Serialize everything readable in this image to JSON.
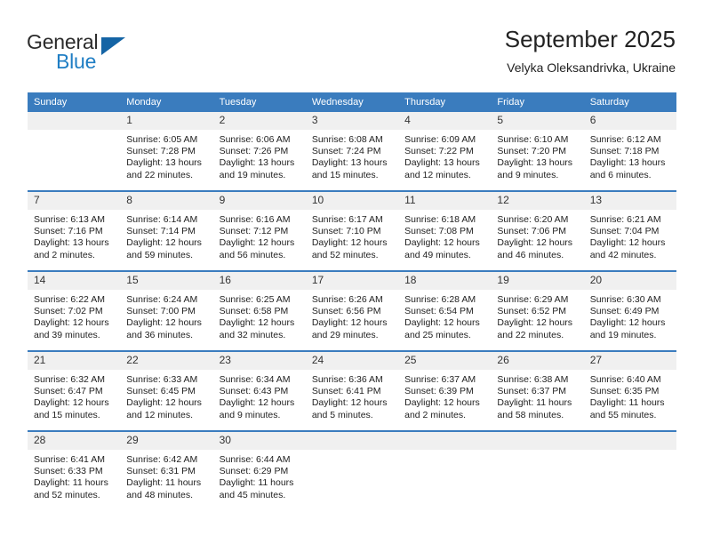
{
  "brand": {
    "name_part1": "General",
    "name_part2": "Blue",
    "accent_color": "#1464a5",
    "blue_text_color": "#1f7ec4"
  },
  "header": {
    "title": "September 2025",
    "subtitle": "Velyka Oleksandrivka, Ukraine",
    "header_bg_color": "#3a7cbe",
    "daynum_bg_color": "#f0f0f0"
  },
  "weekday_headers": [
    "Sunday",
    "Monday",
    "Tuesday",
    "Wednesday",
    "Thursday",
    "Friday",
    "Saturday"
  ],
  "weeks": [
    [
      {
        "day": "",
        "lines": []
      },
      {
        "day": "1",
        "lines": [
          "Sunrise: 6:05 AM",
          "Sunset: 7:28 PM",
          "Daylight: 13 hours",
          "and 22 minutes."
        ]
      },
      {
        "day": "2",
        "lines": [
          "Sunrise: 6:06 AM",
          "Sunset: 7:26 PM",
          "Daylight: 13 hours",
          "and 19 minutes."
        ]
      },
      {
        "day": "3",
        "lines": [
          "Sunrise: 6:08 AM",
          "Sunset: 7:24 PM",
          "Daylight: 13 hours",
          "and 15 minutes."
        ]
      },
      {
        "day": "4",
        "lines": [
          "Sunrise: 6:09 AM",
          "Sunset: 7:22 PM",
          "Daylight: 13 hours",
          "and 12 minutes."
        ]
      },
      {
        "day": "5",
        "lines": [
          "Sunrise: 6:10 AM",
          "Sunset: 7:20 PM",
          "Daylight: 13 hours",
          "and 9 minutes."
        ]
      },
      {
        "day": "6",
        "lines": [
          "Sunrise: 6:12 AM",
          "Sunset: 7:18 PM",
          "Daylight: 13 hours",
          "and 6 minutes."
        ]
      }
    ],
    [
      {
        "day": "7",
        "lines": [
          "Sunrise: 6:13 AM",
          "Sunset: 7:16 PM",
          "Daylight: 13 hours",
          "and 2 minutes."
        ]
      },
      {
        "day": "8",
        "lines": [
          "Sunrise: 6:14 AM",
          "Sunset: 7:14 PM",
          "Daylight: 12 hours",
          "and 59 minutes."
        ]
      },
      {
        "day": "9",
        "lines": [
          "Sunrise: 6:16 AM",
          "Sunset: 7:12 PM",
          "Daylight: 12 hours",
          "and 56 minutes."
        ]
      },
      {
        "day": "10",
        "lines": [
          "Sunrise: 6:17 AM",
          "Sunset: 7:10 PM",
          "Daylight: 12 hours",
          "and 52 minutes."
        ]
      },
      {
        "day": "11",
        "lines": [
          "Sunrise: 6:18 AM",
          "Sunset: 7:08 PM",
          "Daylight: 12 hours",
          "and 49 minutes."
        ]
      },
      {
        "day": "12",
        "lines": [
          "Sunrise: 6:20 AM",
          "Sunset: 7:06 PM",
          "Daylight: 12 hours",
          "and 46 minutes."
        ]
      },
      {
        "day": "13",
        "lines": [
          "Sunrise: 6:21 AM",
          "Sunset: 7:04 PM",
          "Daylight: 12 hours",
          "and 42 minutes."
        ]
      }
    ],
    [
      {
        "day": "14",
        "lines": [
          "Sunrise: 6:22 AM",
          "Sunset: 7:02 PM",
          "Daylight: 12 hours",
          "and 39 minutes."
        ]
      },
      {
        "day": "15",
        "lines": [
          "Sunrise: 6:24 AM",
          "Sunset: 7:00 PM",
          "Daylight: 12 hours",
          "and 36 minutes."
        ]
      },
      {
        "day": "16",
        "lines": [
          "Sunrise: 6:25 AM",
          "Sunset: 6:58 PM",
          "Daylight: 12 hours",
          "and 32 minutes."
        ]
      },
      {
        "day": "17",
        "lines": [
          "Sunrise: 6:26 AM",
          "Sunset: 6:56 PM",
          "Daylight: 12 hours",
          "and 29 minutes."
        ]
      },
      {
        "day": "18",
        "lines": [
          "Sunrise: 6:28 AM",
          "Sunset: 6:54 PM",
          "Daylight: 12 hours",
          "and 25 minutes."
        ]
      },
      {
        "day": "19",
        "lines": [
          "Sunrise: 6:29 AM",
          "Sunset: 6:52 PM",
          "Daylight: 12 hours",
          "and 22 minutes."
        ]
      },
      {
        "day": "20",
        "lines": [
          "Sunrise: 6:30 AM",
          "Sunset: 6:49 PM",
          "Daylight: 12 hours",
          "and 19 minutes."
        ]
      }
    ],
    [
      {
        "day": "21",
        "lines": [
          "Sunrise: 6:32 AM",
          "Sunset: 6:47 PM",
          "Daylight: 12 hours",
          "and 15 minutes."
        ]
      },
      {
        "day": "22",
        "lines": [
          "Sunrise: 6:33 AM",
          "Sunset: 6:45 PM",
          "Daylight: 12 hours",
          "and 12 minutes."
        ]
      },
      {
        "day": "23",
        "lines": [
          "Sunrise: 6:34 AM",
          "Sunset: 6:43 PM",
          "Daylight: 12 hours",
          "and 9 minutes."
        ]
      },
      {
        "day": "24",
        "lines": [
          "Sunrise: 6:36 AM",
          "Sunset: 6:41 PM",
          "Daylight: 12 hours",
          "and 5 minutes."
        ]
      },
      {
        "day": "25",
        "lines": [
          "Sunrise: 6:37 AM",
          "Sunset: 6:39 PM",
          "Daylight: 12 hours",
          "and 2 minutes."
        ]
      },
      {
        "day": "26",
        "lines": [
          "Sunrise: 6:38 AM",
          "Sunset: 6:37 PM",
          "Daylight: 11 hours",
          "and 58 minutes."
        ]
      },
      {
        "day": "27",
        "lines": [
          "Sunrise: 6:40 AM",
          "Sunset: 6:35 PM",
          "Daylight: 11 hours",
          "and 55 minutes."
        ]
      }
    ],
    [
      {
        "day": "28",
        "lines": [
          "Sunrise: 6:41 AM",
          "Sunset: 6:33 PM",
          "Daylight: 11 hours",
          "and 52 minutes."
        ]
      },
      {
        "day": "29",
        "lines": [
          "Sunrise: 6:42 AM",
          "Sunset: 6:31 PM",
          "Daylight: 11 hours",
          "and 48 minutes."
        ]
      },
      {
        "day": "30",
        "lines": [
          "Sunrise: 6:44 AM",
          "Sunset: 6:29 PM",
          "Daylight: 11 hours",
          "and 45 minutes."
        ]
      },
      {
        "day": "",
        "lines": []
      },
      {
        "day": "",
        "lines": []
      },
      {
        "day": "",
        "lines": []
      },
      {
        "day": "",
        "lines": []
      }
    ]
  ]
}
